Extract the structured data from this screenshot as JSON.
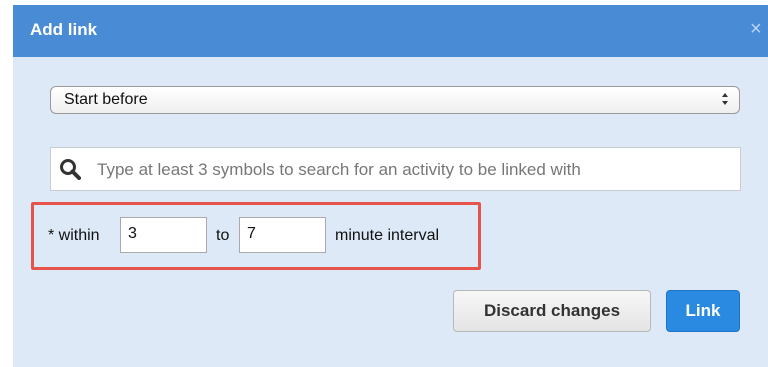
{
  "dialog": {
    "title": "Add link",
    "close_icon": "close-icon",
    "close_glyph": "×"
  },
  "link_type": {
    "selected": "Start before"
  },
  "search": {
    "icon": "search-icon",
    "placeholder": "Type at least 3 symbols to search for an activity to be linked with"
  },
  "interval": {
    "prefix": "* within",
    "from_value": "3",
    "separator": "to",
    "to_value": "7",
    "suffix": "minute interval",
    "highlight_color": "#e5534b"
  },
  "actions": {
    "discard_label": "Discard changes",
    "link_label": "Link"
  },
  "colors": {
    "titlebar": "#4a8bd6",
    "dialog_body": "#dde9f6",
    "primary_button": "#2a8ae2"
  }
}
